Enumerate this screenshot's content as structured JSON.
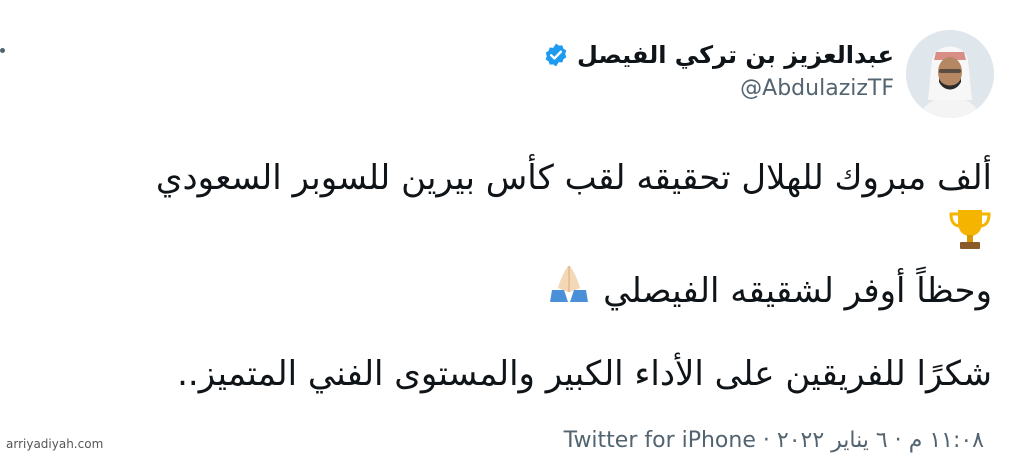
{
  "author": {
    "display_name": "عبدالعزيز بن تركي الفيصل",
    "handle": "@AbdulazizTF",
    "verified_icon": "verified-badge-icon",
    "avatar_icon": "profile-avatar"
  },
  "tweet": {
    "line1": "ألف مبروك للهلال تحقيقه لقب كأس بيرين للسوبر السعودي",
    "line1_emoji": "trophy-icon",
    "line2": "وحظاً أوفر لشقيقه الفيصلي",
    "line2_emoji": "folded-hands-icon",
    "line3": "شكرًا للفريقين على الأداء الكبير والمستوى الفني المتميز.."
  },
  "meta": {
    "time": "١١:٠٨ م",
    "separator": " · ",
    "date": "٦ يناير ٢٠٢٢",
    "source": "Twitter for iPhone"
  },
  "watermark": "arriyadiyah.com",
  "colors": {
    "text": "#0f1419",
    "secondary": "#536471",
    "verified": "#1d9bf0",
    "trophy": "#f4b400"
  }
}
